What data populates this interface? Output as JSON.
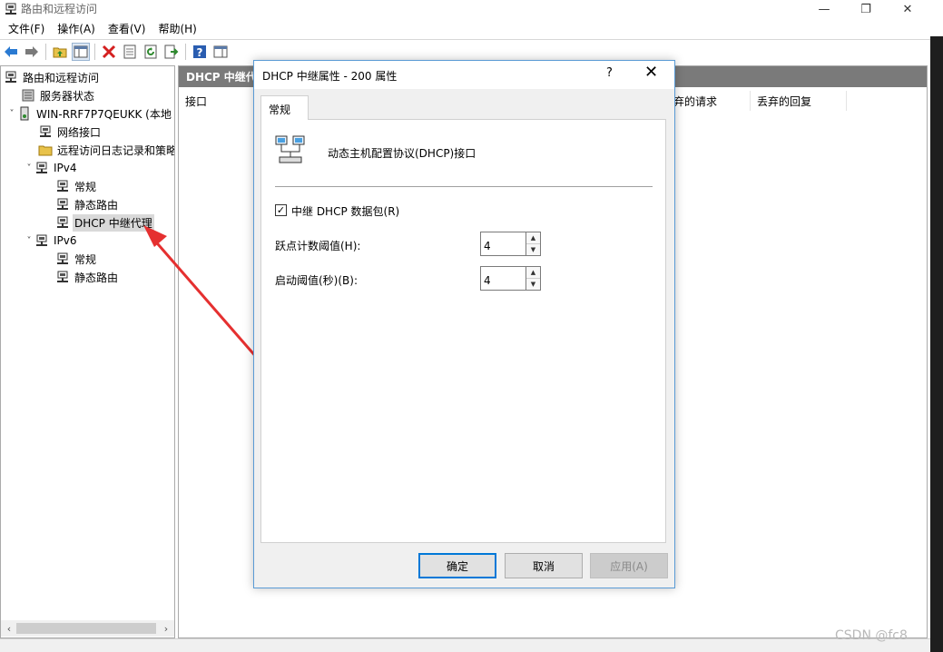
{
  "window": {
    "title": "路由和远程访问",
    "min": "—",
    "max": "❐",
    "close": "✕"
  },
  "menu": [
    "文件(F)",
    "操作(A)",
    "查看(V)",
    "帮助(H)"
  ],
  "tree": {
    "root": "路由和远程访问",
    "server_status": "服务器状态",
    "server": "WIN-RRF7P7QEUKK (本地",
    "network_interfaces": "网络接口",
    "remote_access_logging": "远程访问日志记录和策略",
    "ipv4": "IPv4",
    "ipv4_general": "常规",
    "ipv4_static_routes": "静态路由",
    "ipv4_dhcp_relay": "DHCP 中继代理",
    "ipv6": "IPv6",
    "ipv6_general": "常规",
    "ipv6_static_routes": "静态路由"
  },
  "right_pane": {
    "header": "DHCP 中继代",
    "columns": {
      "interface": "接口",
      "discarded_requests": "弃的请求",
      "discarded_replies": "丢弃的回复"
    }
  },
  "dialog": {
    "title": "DHCP 中继属性 - 200 属性",
    "help": "?",
    "close": "✕",
    "tab": "常规",
    "description": "动态主机配置协议(DHCP)接口",
    "relay_checkbox_label": "中继 DHCP 数据包(R)",
    "relay_checked": true,
    "hop_count_label": "跃点计数阈值(H):",
    "hop_count_value": "4",
    "boot_threshold_label": "启动阈值(秒)(B):",
    "boot_threshold_value": "4",
    "ok": "确定",
    "cancel": "取消",
    "apply": "应用(A)"
  },
  "watermark": "CSDN @fc8",
  "colors": {
    "accent": "#0078d7",
    "arrow": "#e53030",
    "header": "#7a7a7a"
  }
}
